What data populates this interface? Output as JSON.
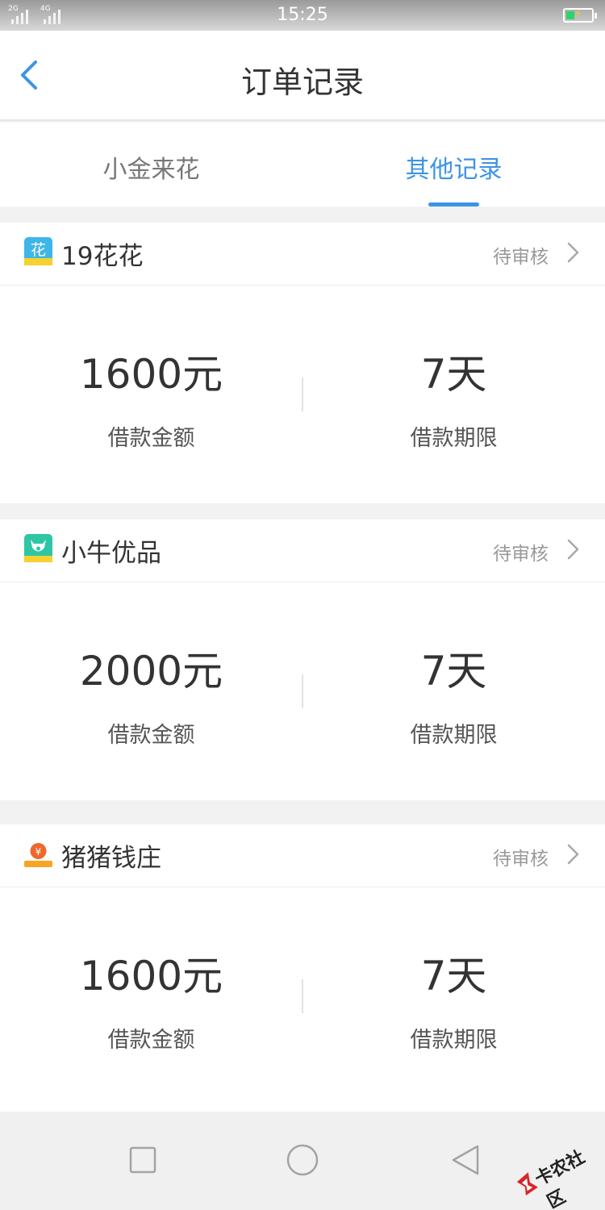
{
  "status_bar": {
    "time": "15:25",
    "sim1_label": "2G",
    "sim2_label": "4G"
  },
  "header": {
    "title": "订单记录",
    "back_icon": "chevron-left-icon"
  },
  "tabs": [
    {
      "label": "小金来花",
      "active": false
    },
    {
      "label": "其他记录",
      "active": true
    }
  ],
  "accent_color": "#3d94e6",
  "orders": [
    {
      "name": "19花花",
      "logo": "flower-logo-icon",
      "logo_text": "花",
      "status": "待审核",
      "amount": "1600元",
      "amount_label": "借款金额",
      "term": "7天",
      "term_label": "借款期限"
    },
    {
      "name": "小牛优品",
      "logo": "bull-logo-icon",
      "logo_text": "",
      "status": "待审核",
      "amount": "2000元",
      "amount_label": "借款金额",
      "term": "7天",
      "term_label": "借款期限"
    },
    {
      "name": "猪猪钱庄",
      "logo": "pig-logo-icon",
      "logo_text": "¥",
      "status": "待审核",
      "amount": "1600元",
      "amount_label": "借款金额",
      "term": "7天",
      "term_label": "借款期限"
    }
  ],
  "system_nav": {
    "recent": "square-icon",
    "home": "circle-icon",
    "back": "triangle-back-icon"
  },
  "watermark": {
    "text": "卡农社区"
  }
}
